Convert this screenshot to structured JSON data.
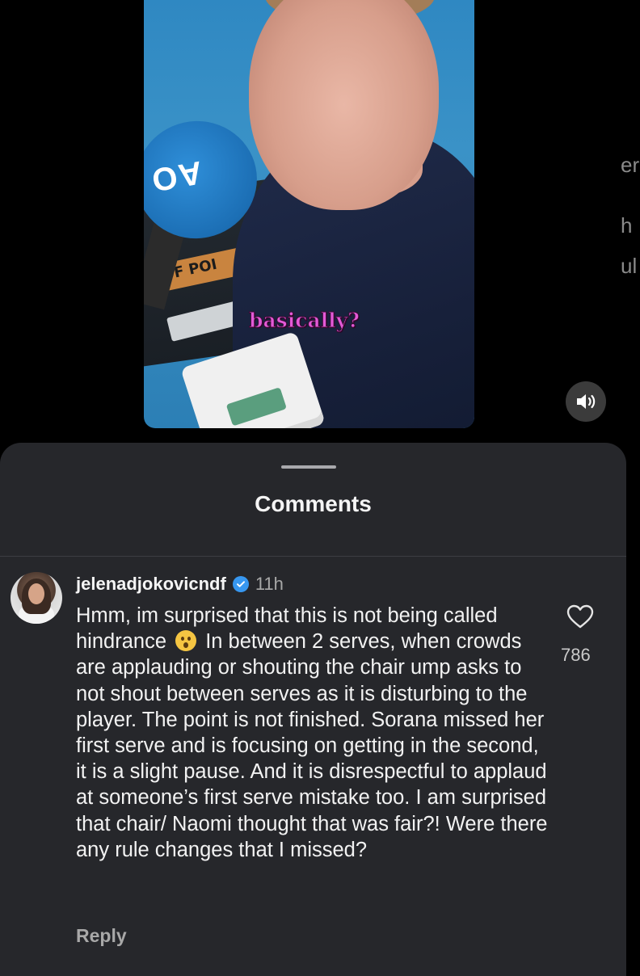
{
  "video": {
    "caption": "basically?",
    "mic_text": "AO",
    "scoreboard_text": "OF POI",
    "sound_button": "sound-icon",
    "right_fragments": [
      "er",
      "h",
      "ul"
    ]
  },
  "comments_sheet": {
    "title": "Comments",
    "comment": {
      "username": "jelenadjokovicndf",
      "verified_icon": "verified-badge-icon",
      "time": "11h",
      "text_before_emoji": "Hmm, im surprised that this is not being called hindrance",
      "emoji": "hushed-face-emoji",
      "text_after_emoji": "In between 2 serves, when crowds are applauding or shouting the chair ump asks to not shout between serves as it is disturbing to the player. The point is not finished. Sorana missed her first serve and is focusing on getting in the second, it is a slight pause. And it is disrespectful to applaud at someone’s first serve mistake too. I am surprised that chair/ Naomi thought that was fair?! Were there any rule changes that I missed?",
      "like_icon": "heart-icon",
      "like_count": "786",
      "reply_label": "Reply"
    }
  },
  "colors": {
    "sheet_bg": "#26272b",
    "caption": "#e35ad7",
    "verified": "#3797f0"
  }
}
